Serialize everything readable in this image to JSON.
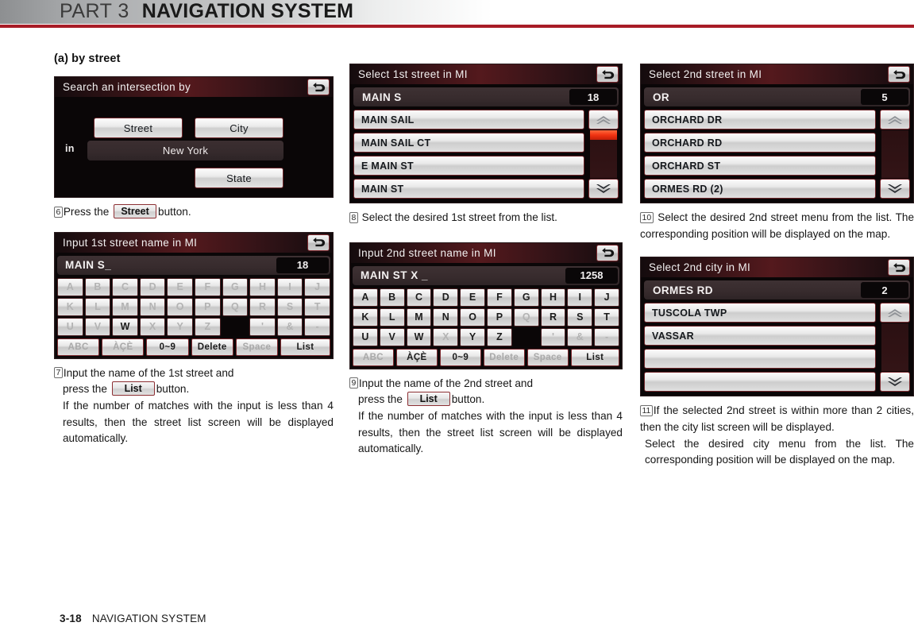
{
  "header": {
    "part": "PART 3",
    "title": "NAVIGATION SYSTEM"
  },
  "footer": {
    "page": "3-18",
    "section": "NAVIGATION SYSTEM"
  },
  "section_heading": "(a) by street",
  "screens": {
    "search_intersection": {
      "title": "Search an intersection by",
      "back_icon": "back-arrow-icon",
      "street_button": "Street",
      "city_button": "City",
      "in_label": "in",
      "city_value": "New York",
      "state_button": "State"
    },
    "input_1st_street": {
      "title": "Input 1st street name in MI",
      "back_icon": "back-arrow-icon",
      "input_value": "MAIN S_",
      "match_count": "18",
      "keys_row1": [
        "A",
        "B",
        "C",
        "D",
        "E",
        "F",
        "G",
        "H",
        "I",
        "J"
      ],
      "keys_row1_dim": [
        false,
        true,
        true,
        true,
        true,
        true,
        true,
        true,
        true,
        true
      ],
      "keys_row2": [
        "K",
        "L",
        "M",
        "N",
        "O",
        "P",
        "Q",
        "R",
        "S",
        "T"
      ],
      "keys_row2_dim": [
        true,
        true,
        true,
        true,
        true,
        true,
        true,
        true,
        true,
        true
      ],
      "keys_row3": [
        "U",
        "V",
        "W",
        "X",
        "Y",
        "Z",
        "",
        "'",
        "&",
        "-"
      ],
      "keys_row3_dim": [
        true,
        true,
        false,
        true,
        true,
        true,
        true,
        true,
        true,
        true
      ],
      "fn_keys": [
        "ABC",
        "ÀÇÈ",
        "0~9",
        "Delete",
        "Space",
        "List"
      ],
      "fn_keys_dim": [
        true,
        true,
        false,
        false,
        true,
        false
      ]
    },
    "select_1st_street": {
      "title": "Select 1st street in MI",
      "back_icon": "back-arrow-icon",
      "query": "MAIN S",
      "match_count": "18",
      "items": [
        "MAIN SAIL",
        "MAIN SAIL CT",
        "E MAIN ST",
        "MAIN ST"
      ],
      "scroll_up_icon": "chevron-up-icon",
      "scroll_down_icon": "chevron-down-icon",
      "scroll_thumb_visible": true
    },
    "input_2nd_street": {
      "title": "Input 2nd street name in MI",
      "back_icon": "back-arrow-icon",
      "input_value": "MAIN ST X _",
      "match_count": "1258",
      "keys_row1": [
        "A",
        "B",
        "C",
        "D",
        "E",
        "F",
        "G",
        "H",
        "I",
        "J"
      ],
      "keys_row1_dim": [
        false,
        false,
        false,
        false,
        false,
        false,
        false,
        false,
        false,
        false
      ],
      "keys_row2": [
        "K",
        "L",
        "M",
        "N",
        "O",
        "P",
        "Q",
        "R",
        "S",
        "T"
      ],
      "keys_row2_dim": [
        false,
        false,
        false,
        false,
        false,
        false,
        true,
        false,
        false,
        false
      ],
      "keys_row3": [
        "U",
        "V",
        "W",
        "X",
        "Y",
        "Z",
        "",
        "'",
        "&",
        "-"
      ],
      "keys_row3_dim": [
        false,
        false,
        false,
        true,
        false,
        false,
        true,
        true,
        true,
        true
      ],
      "fn_keys": [
        "ABC",
        "ÀÇÈ",
        "0~9",
        "Delete",
        "Space",
        "List"
      ],
      "fn_keys_dim": [
        true,
        false,
        false,
        true,
        true,
        false
      ]
    },
    "select_2nd_street": {
      "title": "Select 2nd street in MI",
      "back_icon": "back-arrow-icon",
      "query": "OR",
      "match_count": "5",
      "items": [
        "ORCHARD DR",
        "ORCHARD RD",
        "ORCHARD ST",
        "ORMES RD (2)"
      ],
      "scroll_up_icon": "chevron-up-icon",
      "scroll_down_icon": "chevron-down-icon",
      "scroll_thumb_visible": false
    },
    "select_2nd_city": {
      "title": "Select 2nd city in MI",
      "back_icon": "back-arrow-icon",
      "query": "ORMES RD",
      "match_count": "2",
      "items": [
        "TUSCOLA TWP",
        "VASSAR",
        "",
        ""
      ],
      "scroll_up_icon": "chevron-up-icon",
      "scroll_down_icon": "chevron-down-icon",
      "scroll_thumb_visible": false
    }
  },
  "steps": {
    "s6": {
      "num": "6",
      "pre": "Press the",
      "button": "Street",
      "post": "button."
    },
    "s7": {
      "num": "7",
      "line1": "Input the name of the 1st street and",
      "pre2": "press the",
      "button": "List",
      "post2": "button.",
      "body": "If the number of matches with the input is less than 4 results, then the street list screen will be displayed automatically."
    },
    "s8": {
      "num": "8",
      "text": "Select the desired 1st street from the list."
    },
    "s9": {
      "num": "9",
      "line1": "Input the name of the 2nd street and",
      "pre2": "press the",
      "button": "List",
      "post2": "button.",
      "body": "If the number of matches with the input is less than 4 results, then the street list screen will be displayed automatically."
    },
    "s10": {
      "num": "10",
      "text": "Select the desired 2nd street menu from the list. The corresponding position will be displayed on the map."
    },
    "s11": {
      "num": "11",
      "line1": "If the selected 2nd street is within more than 2 cities, then the city list screen will be displayed.",
      "body": "Select the desired city menu from the list. The corresponding position will be displayed on the map."
    }
  },
  "colors": {
    "accent_red": "#a81c26",
    "scroll_thumb": "#f03312",
    "panel_bg": "#0a0607",
    "title_bar": "#54191d"
  }
}
